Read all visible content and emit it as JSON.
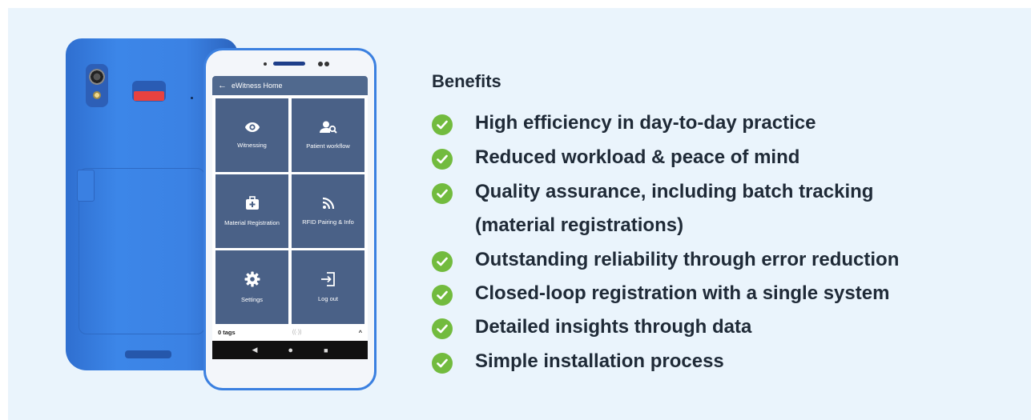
{
  "device": {
    "app_title": "eWitness Home",
    "tiles": [
      {
        "label": "Witnessing",
        "icon": "eye-icon"
      },
      {
        "label": "Patient workflow",
        "icon": "user-search-icon"
      },
      {
        "label": "Material Registration",
        "icon": "medical-kit-icon"
      },
      {
        "label": "RFID Pairing & Info",
        "icon": "rss-icon"
      },
      {
        "label": "Settings",
        "icon": "gear-icon"
      },
      {
        "label": "Log out",
        "icon": "logout-icon"
      }
    ],
    "status_tags": "0 tags",
    "status_rfid": "((·))",
    "status_arrow": "^",
    "nav": {
      "back": "◀",
      "home": "●",
      "recents": "■"
    },
    "back_glyph": "←"
  },
  "benefits": {
    "title": "Benefits",
    "check_color": "#72bb3e",
    "items": [
      "High efficiency in day-to-day practice",
      "Reduced workload & peace of mind",
      "Quality assurance, including batch tracking",
      "(material registrations)",
      "Outstanding reliability through error reduction",
      "Closed-loop registration with a single system",
      "Detailed insights through data",
      "Simple installation process"
    ]
  }
}
